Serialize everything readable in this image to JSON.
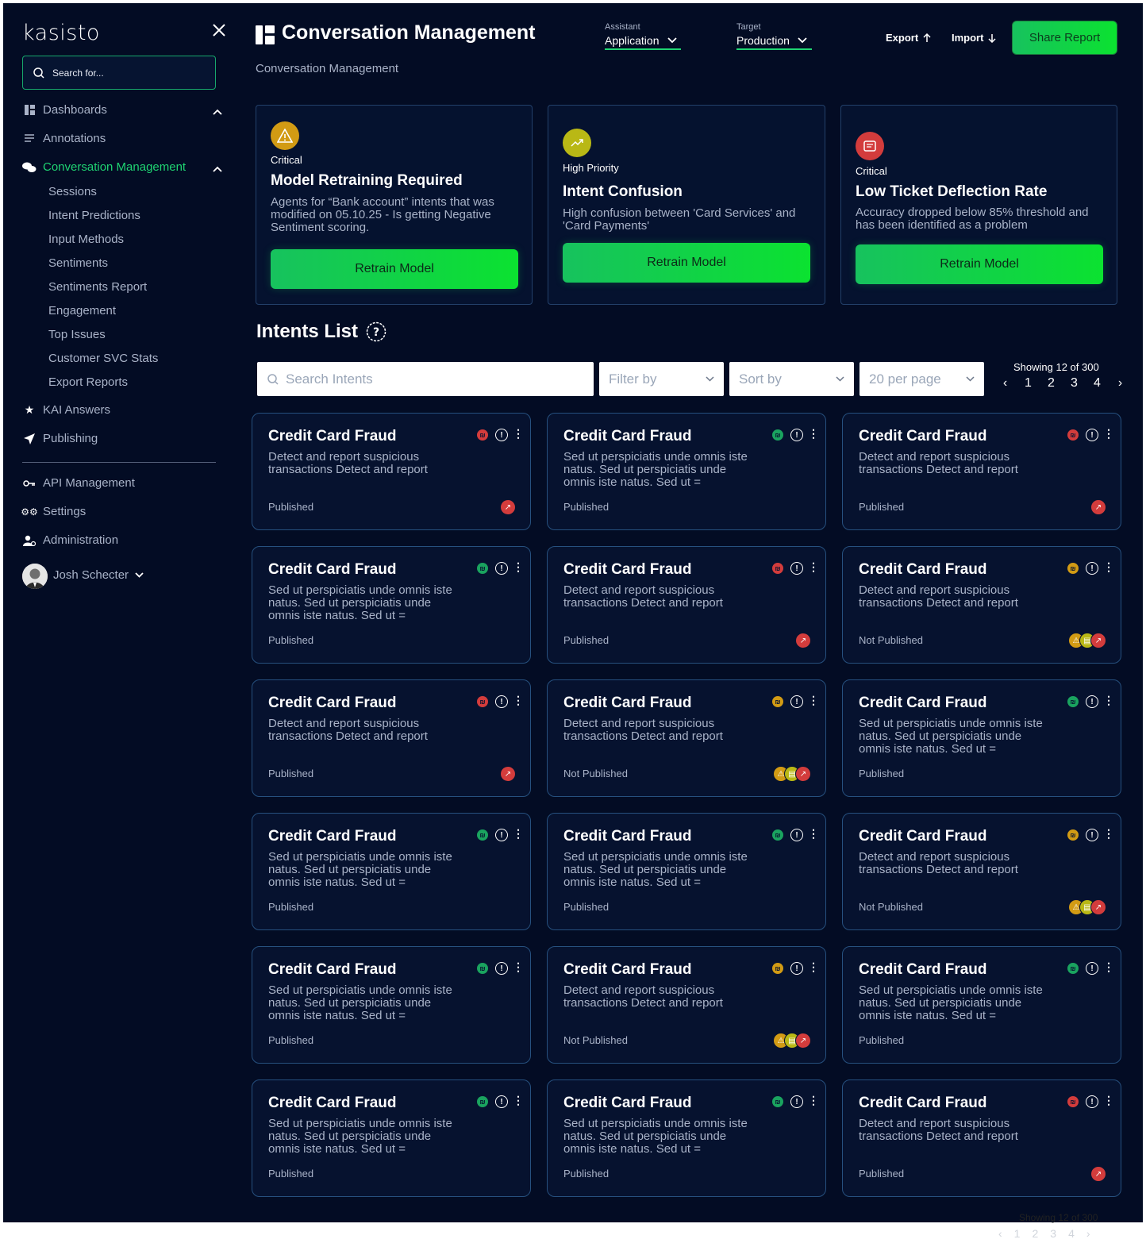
{
  "app": {
    "logo": "kasisto"
  },
  "sidebar": {
    "search_placeholder": "Search for...",
    "nav": [
      {
        "label": "Dashboards",
        "icon": "dashboard-icon"
      },
      {
        "label": "Annotations",
        "icon": "annotations-icon"
      },
      {
        "label": "Conversation Management",
        "icon": "chat-icon"
      },
      {
        "label": "KAI Answers",
        "icon": "star-icon"
      },
      {
        "label": "Publishing",
        "icon": "send-icon"
      },
      {
        "label": "API Management",
        "icon": "key-icon"
      },
      {
        "label": "Settings",
        "icon": "gears-icon"
      },
      {
        "label": "Administration",
        "icon": "admin-icon"
      }
    ],
    "sub_items": [
      "Sessions",
      "Intent Predictions",
      "Input Methods",
      "Sentiments",
      "Sentiments Report",
      "Engagement",
      "Top Issues",
      "Customer SVC Stats",
      "Export Reports"
    ],
    "user": "Josh Schecter"
  },
  "header": {
    "title": "Conversation Management",
    "breadcrumb": "Conversation Management",
    "assistant_label": "Assistant",
    "assistant_value": "Application",
    "target_label": "Target",
    "target_value": "Production",
    "export_label": "Export",
    "import_label": "Import",
    "share_label": "Share Report"
  },
  "alerts": [
    {
      "severity": "Critical",
      "title": "Model Retraining Required",
      "desc": "Agents for “Bank account” intents that was  modified on 05.10.25 - Is getting Negative Sentiment scoring.",
      "button": "Retrain Model",
      "icon": "warning-icon",
      "color": "#d29b14"
    },
    {
      "severity": "High Priority",
      "title": "Intent Confusion",
      "desc": "High confusion between 'Card Services' and 'Card Payments'",
      "button": "Retrain Model",
      "icon": "trend-icon",
      "color": "#b9b815"
    },
    {
      "severity": "Critical",
      "title": "Low Ticket Deflection Rate",
      "desc": "Accuracy dropped below 85% threshold and has been identified as a problem",
      "button": "Retrain Model",
      "icon": "message-icon",
      "color": "#d33c3c"
    }
  ],
  "intents": {
    "title": "Intents List",
    "search_placeholder": "Search Intents",
    "filter_label": "Filter by",
    "sort_label": "Sort by",
    "per_page_label": "20 per page",
    "showing": "Showing 12 of 300",
    "pages": [
      "1",
      "2",
      "3",
      "4"
    ],
    "cards": [
      {
        "title": "Credit Card Fraud",
        "desc": "Detect and report suspicious transactions Detect and report",
        "status": "Published",
        "dot": "red",
        "badges": [
          "red"
        ]
      },
      {
        "title": "Credit Card Fraud",
        "desc": "Sed ut perspiciatis unde omnis iste natus. Sed ut perspiciatis unde omnis iste natus. Sed ut =",
        "status": "Published",
        "dot": "green",
        "badges": []
      },
      {
        "title": "Credit Card Fraud",
        "desc": "Detect and report suspicious transactions Detect and report",
        "status": "Published",
        "dot": "red",
        "badges": [
          "red"
        ]
      },
      {
        "title": "Credit Card Fraud",
        "desc": "Sed ut perspiciatis unde omnis iste natus. Sed ut perspiciatis unde omnis iste natus. Sed ut =",
        "status": "Published",
        "dot": "green",
        "badges": []
      },
      {
        "title": "Credit Card Fraud",
        "desc": "Detect and report suspicious transactions Detect and report",
        "status": "Published",
        "dot": "red",
        "badges": [
          "red"
        ]
      },
      {
        "title": "Credit Card Fraud",
        "desc": "Detect and report suspicious transactions Detect and report",
        "status": "Not Published",
        "dot": "orange",
        "badges": [
          "orange",
          "yellow",
          "red"
        ]
      },
      {
        "title": "Credit Card Fraud",
        "desc": "Detect and report suspicious transactions Detect and report",
        "status": "Published",
        "dot": "red",
        "badges": [
          "red"
        ]
      },
      {
        "title": "Credit Card Fraud",
        "desc": "Detect and report suspicious transactions Detect and report",
        "status": "Not Published",
        "dot": "orange",
        "badges": [
          "orange",
          "yellow",
          "red"
        ]
      },
      {
        "title": "Credit Card Fraud",
        "desc": "Sed ut perspiciatis unde omnis iste natus. Sed ut perspiciatis unde omnis iste natus. Sed ut =",
        "status": "Published",
        "dot": "green",
        "badges": []
      },
      {
        "title": "Credit Card Fraud",
        "desc": "Sed ut perspiciatis unde omnis iste natus. Sed ut perspiciatis unde omnis iste natus. Sed ut =",
        "status": "Published",
        "dot": "green",
        "badges": []
      },
      {
        "title": "Credit Card Fraud",
        "desc": "Sed ut perspiciatis unde omnis iste natus. Sed ut perspiciatis unde omnis iste natus. Sed ut =",
        "status": "Published",
        "dot": "green",
        "badges": []
      },
      {
        "title": "Credit Card Fraud",
        "desc": "Detect and report suspicious transactions Detect and report",
        "status": "Not Published",
        "dot": "orange",
        "badges": [
          "orange",
          "yellow",
          "red"
        ]
      },
      {
        "title": "Credit Card Fraud",
        "desc": "Sed ut perspiciatis unde omnis iste natus. Sed ut perspiciatis unde omnis iste natus. Sed ut =",
        "status": "Published",
        "dot": "green",
        "badges": []
      },
      {
        "title": "Credit Card Fraud",
        "desc": "Detect and report suspicious transactions Detect and report",
        "status": "Not Published",
        "dot": "orange",
        "badges": [
          "orange",
          "yellow",
          "red"
        ]
      },
      {
        "title": "Credit Card Fraud",
        "desc": "Sed ut perspiciatis unde omnis iste natus. Sed ut perspiciatis unde omnis iste natus. Sed ut =",
        "status": "Published",
        "dot": "green",
        "badges": []
      },
      {
        "title": "Credit Card Fraud",
        "desc": "Sed ut perspiciatis unde omnis iste natus. Sed ut perspiciatis unde omnis iste natus. Sed ut =",
        "status": "Published",
        "dot": "green",
        "badges": []
      },
      {
        "title": "Credit Card Fraud",
        "desc": "Sed ut perspiciatis unde omnis iste natus. Sed ut perspiciatis unde omnis iste natus. Sed ut =",
        "status": "Published",
        "dot": "green",
        "badges": []
      },
      {
        "title": "Credit Card Fraud",
        "desc": "Detect and report suspicious transactions Detect and report",
        "status": "Published",
        "dot": "red",
        "badges": [
          "red"
        ]
      }
    ]
  },
  "footer": {
    "showing": "Showing 12 of 300",
    "pages": [
      "1",
      "2",
      "3",
      "4"
    ]
  },
  "colors": {
    "accent": "#1fd472",
    "bg": "#030c24",
    "card_border": "#26507e",
    "red": "#d33c3c",
    "green": "#1aa35f",
    "orange": "#d29b14",
    "yellow": "#b9b815"
  }
}
